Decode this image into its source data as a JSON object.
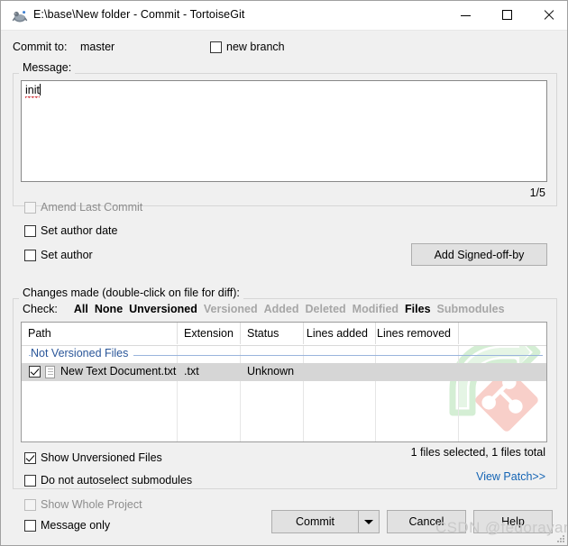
{
  "window": {
    "title": "E:\\base\\New folder - Commit - TortoiseGit",
    "icon": "tortoisegit-icon",
    "controls": {
      "minimize": "minimize-button",
      "maximize": "maximize-button",
      "close": "close-button"
    }
  },
  "commit_to": {
    "label": "Commit to:",
    "branch": "master",
    "new_branch_label": "new branch",
    "new_branch_checked": false
  },
  "message": {
    "group_title": "Message:",
    "value": "init",
    "spellcheck_word": "init",
    "counter": "1/5"
  },
  "options": {
    "amend_last_commit": {
      "label": "Amend Last Commit",
      "checked": false,
      "disabled": true
    },
    "set_author_date": {
      "label": "Set author date",
      "checked": false,
      "disabled": false
    },
    "set_author": {
      "label": "Set author",
      "checked": false,
      "disabled": false
    },
    "add_signed_off_by": "Add Signed-off-by"
  },
  "changes": {
    "group_title": "Changes made (double-click on file for diff):",
    "check_label": "Check:",
    "check_links": [
      {
        "label": "All",
        "enabled": true
      },
      {
        "label": "None",
        "enabled": true
      },
      {
        "label": "Unversioned",
        "enabled": true
      },
      {
        "label": "Versioned",
        "enabled": false
      },
      {
        "label": "Added",
        "enabled": false
      },
      {
        "label": "Deleted",
        "enabled": false
      },
      {
        "label": "Modified",
        "enabled": false
      },
      {
        "label": "Files",
        "enabled": true
      },
      {
        "label": "Submodules",
        "enabled": false
      }
    ],
    "columns": [
      "Path",
      "Extension",
      "Status",
      "Lines added",
      "Lines removed"
    ],
    "group_header": "Not Versioned Files",
    "rows": [
      {
        "checked": true,
        "icon": "document-icon",
        "path": "New Text Document.txt",
        "extension": ".txt",
        "status": "Unknown",
        "lines_added": "",
        "lines_removed": "",
        "selected": true
      }
    ],
    "summary": "1 files selected, 1 files total",
    "view_patch": "View Patch>>",
    "show_unversioned": {
      "label": "Show Unversioned Files",
      "checked": true,
      "disabled": false
    },
    "do_not_autoselect_subs": {
      "label": "Do not autoselect submodules",
      "checked": false,
      "disabled": false
    }
  },
  "footer": {
    "show_whole_project": {
      "label": "Show Whole Project",
      "checked": false,
      "disabled": true
    },
    "message_only": {
      "label": "Message only",
      "checked": false,
      "disabled": false
    },
    "commit_button": {
      "pre": "C",
      "accel": "o",
      "post": "mmit"
    },
    "commit_label": "Commit",
    "cancel_label": "Cancel",
    "help_label": "Help"
  },
  "watermark": {
    "text": "CSDN @fedorayang",
    "logo": "tortoisegit-logo-watermark"
  },
  "colors": {
    "window_bg": "#f0f0f0",
    "titlebar_bg": "#ffffff",
    "button_face": "#e1e1e1",
    "link": "#1464b4",
    "group_header_text": "#2a5699",
    "row_selected": "#d6d6d6",
    "disabled_text": "#a6a6a6",
    "spellcheck_underline": "#d0343a",
    "logo_green": "#a8dfa8",
    "logo_salmon": "#ef8273"
  }
}
